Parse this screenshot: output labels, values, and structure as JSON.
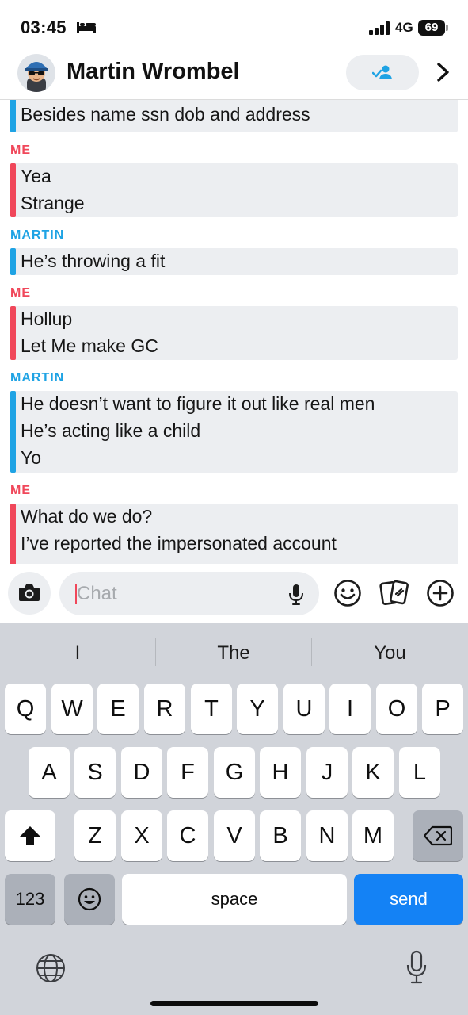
{
  "status_bar": {
    "time": "03:45",
    "network": "4G",
    "battery": "69",
    "icons": [
      "bed-icon",
      "signal-icon",
      "battery-icon"
    ]
  },
  "header": {
    "contact_name": "Martin Wrombel",
    "icons": [
      "avatar",
      "friend-added-icon",
      "chevron-right-icon"
    ]
  },
  "messages": {
    "groups": [
      {
        "sender": "",
        "lines": [
          "Besides name ssn dob and address"
        ]
      },
      {
        "sender": "ME",
        "lines": [
          "Yea",
          "Strange"
        ]
      },
      {
        "sender": "MARTIN",
        "lines": [
          "He’s throwing a fit"
        ]
      },
      {
        "sender": "ME",
        "lines": [
          "Hollup",
          "Let Me make GC"
        ]
      },
      {
        "sender": "MARTIN",
        "lines": [
          "He doesn’t want to figure it out like real men",
          "He’s acting like a child",
          "Yo"
        ]
      },
      {
        "sender": "ME",
        "lines": [
          "What do we do?",
          "I’ve reported the impersonated account"
        ]
      }
    ]
  },
  "input_bar": {
    "placeholder": "Chat",
    "icons": [
      "camera-icon",
      "microphone-icon",
      "emoji-icon",
      "cards-icon",
      "plus-icon"
    ]
  },
  "keyboard": {
    "suggestions": [
      "I",
      "The",
      "You"
    ],
    "row1": [
      "Q",
      "W",
      "E",
      "R",
      "T",
      "Y",
      "U",
      "I",
      "O",
      "P"
    ],
    "row2": [
      "A",
      "S",
      "D",
      "F",
      "G",
      "H",
      "J",
      "K",
      "L"
    ],
    "row3": [
      "Z",
      "X",
      "C",
      "V",
      "B",
      "N",
      "M"
    ],
    "numbers_label": "123",
    "space_label": "space",
    "send_label": "send",
    "icons": [
      "shift-icon",
      "backspace-icon",
      "emoji-key-icon",
      "globe-icon",
      "dictation-icon"
    ],
    "colors": {
      "send": "#1482f5",
      "me_accent": "#f0475a",
      "martin_accent": "#1fa3e4"
    }
  }
}
